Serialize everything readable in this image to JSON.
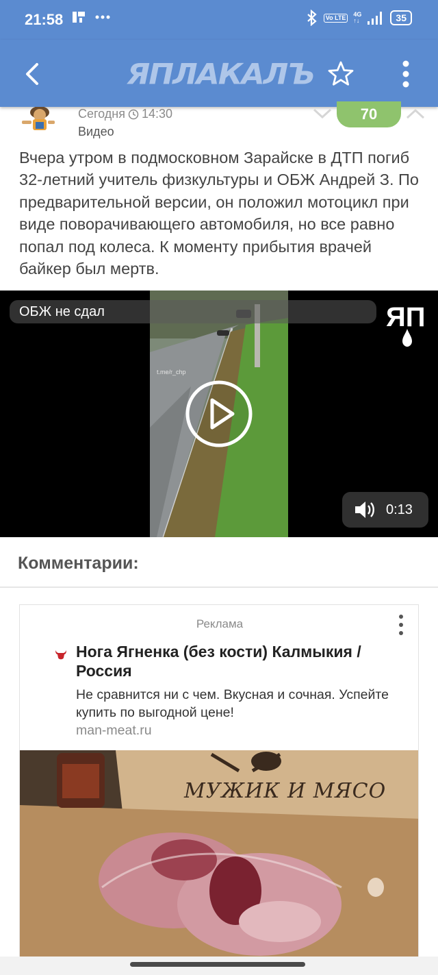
{
  "status_bar": {
    "time": "21:58",
    "battery": "35",
    "network": "4G",
    "volte": "Vo LTE"
  },
  "app_bar": {
    "logo": "ЯПЛАКАЛЪ"
  },
  "post": {
    "date": "Сегодня",
    "time": "14:30",
    "category": "Видео",
    "rating": "70",
    "text": "Вчера утром в подмосковном Зарайске в ДТП погиб 32-летний учитель физкультуры и ОБЖ Андрей З. По предварительной версии, он положил мотоцикл при виде поворачивающего автомобиля, но все равно попал под колеса. К моменту прибытия врачей байкер был мертв."
  },
  "video": {
    "title": "ОБЖ не сдал",
    "watermark": "t.me/r_chp",
    "duration": "0:13",
    "logo_text": "ЯП"
  },
  "comments": {
    "title": "Комментарии:"
  },
  "ad": {
    "label": "Реклама",
    "title": "Нога Ягненка (без кости) Калмыкия / Россия",
    "description": "Не сравнится ни с чем. Вкусная и сочная. Успейте купить по выгодной цене!",
    "domain": "man-meat.ru",
    "brand": "МУЖИК И МЯСО"
  },
  "colors": {
    "app_bar": "#5b8bd0",
    "rating_bg": "#8fc36d",
    "video_bg": "#000000"
  },
  "icons": [
    "back-arrow-icon",
    "star-icon",
    "more-vert-icon",
    "clock-icon",
    "chevron-down-icon",
    "chevron-up-icon",
    "play-icon",
    "volume-icon",
    "bluetooth-icon",
    "signal-icon",
    "battery-icon"
  ]
}
